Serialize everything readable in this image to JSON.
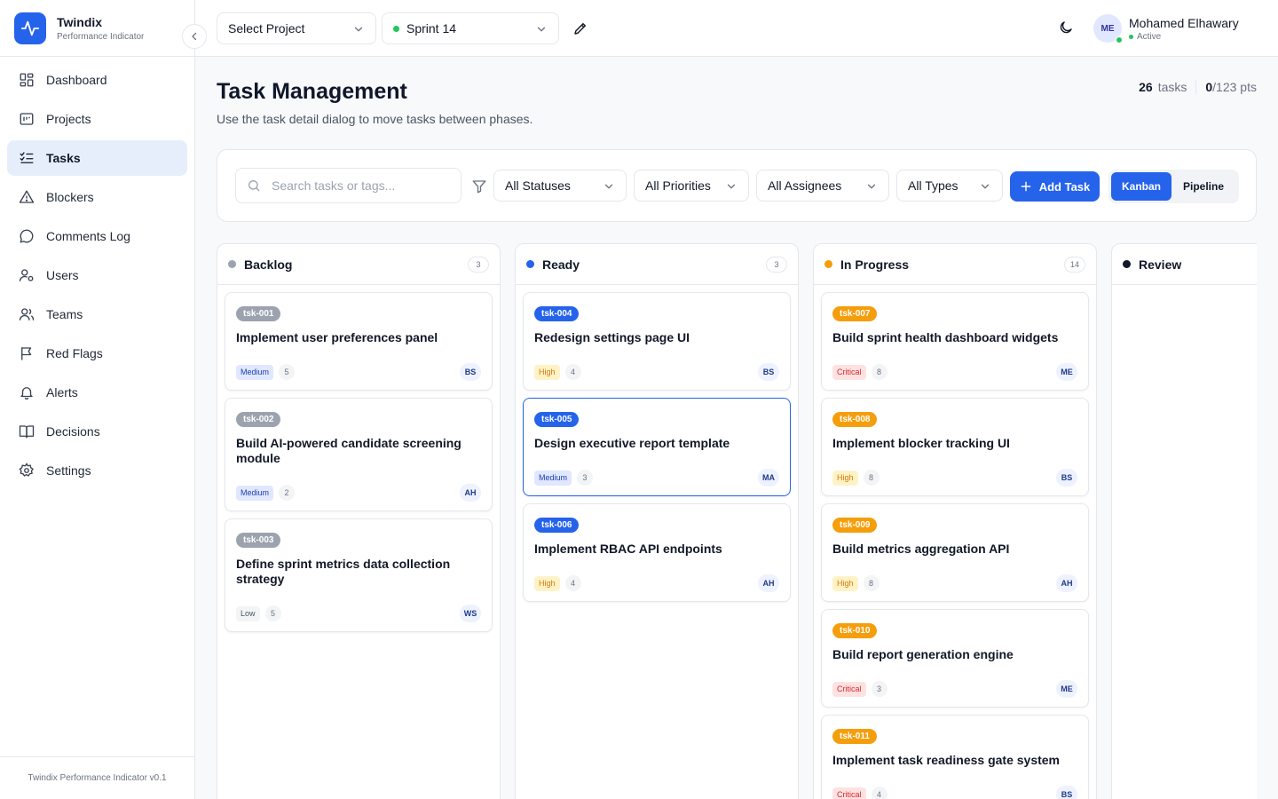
{
  "brand": {
    "name": "Twindix",
    "subtitle": "Performance Indicator"
  },
  "sidebar": {
    "items": [
      {
        "label": "Dashboard",
        "icon": "dashboard-icon"
      },
      {
        "label": "Projects",
        "icon": "projects-icon"
      },
      {
        "label": "Tasks",
        "icon": "tasks-icon",
        "active": true
      },
      {
        "label": "Blockers",
        "icon": "warning-icon"
      },
      {
        "label": "Comments Log",
        "icon": "comment-icon"
      },
      {
        "label": "Users",
        "icon": "user-gear-icon"
      },
      {
        "label": "Teams",
        "icon": "teams-icon"
      },
      {
        "label": "Red Flags",
        "icon": "flag-icon"
      },
      {
        "label": "Alerts",
        "icon": "bell-icon"
      },
      {
        "label": "Decisions",
        "icon": "book-icon"
      },
      {
        "label": "Settings",
        "icon": "gear-icon"
      }
    ],
    "footer": "Twindix Performance Indicator v0.1"
  },
  "topbar": {
    "project_select": "Select Project",
    "sprint_select": "Sprint 14",
    "user": {
      "initials": "ME",
      "name": "Mohamed Elhawary",
      "status": "Active"
    }
  },
  "page": {
    "title": "Task Management",
    "subtitle": "Use the task detail dialog to move tasks between phases.",
    "stats": {
      "tasks_count": "26",
      "tasks_label": "tasks",
      "points_done": "0",
      "points_total": "/123 pts"
    }
  },
  "toolbar": {
    "search_placeholder": "Search tasks or tags...",
    "status_filter": "All Statuses",
    "priority_filter": "All Priorities",
    "assignee_filter": "All Assignees",
    "type_filter": "All Types",
    "add_label": "Add Task",
    "view_kanban": "Kanban",
    "view_pipeline": "Pipeline"
  },
  "colors": {
    "accent": "#2563eb",
    "gray_dot": "#9ca3af",
    "orange": "#f59e0b",
    "critical": "#dc2626",
    "high": "#d97706",
    "medium": "#1d4ed8",
    "low": "#4b5563"
  },
  "columns": [
    {
      "title": "Backlog",
      "count": "3",
      "cards": [
        {
          "id": "tsk-001",
          "title": "Implement user preferences panel",
          "priority": "Medium",
          "points": "5",
          "assignee": "BS"
        },
        {
          "id": "tsk-002",
          "title": "Build AI-powered candidate screening module",
          "priority": "Medium",
          "points": "2",
          "assignee": "AH"
        },
        {
          "id": "tsk-003",
          "title": "Define sprint metrics data collection strategy",
          "priority": "Low",
          "points": "5",
          "assignee": "WS"
        }
      ]
    },
    {
      "title": "Ready",
      "count": "3",
      "cards": [
        {
          "id": "tsk-004",
          "title": "Redesign settings page UI",
          "priority": "High",
          "points": "4",
          "assignee": "BS"
        },
        {
          "id": "tsk-005",
          "title": "Design executive report template",
          "priority": "Medium",
          "points": "3",
          "assignee": "MA"
        },
        {
          "id": "tsk-006",
          "title": "Implement RBAC API endpoints",
          "priority": "High",
          "points": "4",
          "assignee": "AH"
        }
      ]
    },
    {
      "title": "In Progress",
      "count": "14",
      "cards": [
        {
          "id": "tsk-007",
          "title": "Build sprint health dashboard widgets",
          "priority": "Critical",
          "points": "8",
          "assignee": "ME"
        },
        {
          "id": "tsk-008",
          "title": "Implement blocker tracking UI",
          "priority": "High",
          "points": "8",
          "assignee": "BS"
        },
        {
          "id": "tsk-009",
          "title": "Build metrics aggregation API",
          "priority": "High",
          "points": "8",
          "assignee": "AH"
        },
        {
          "id": "tsk-010",
          "title": "Build report generation engine",
          "priority": "Critical",
          "points": "3",
          "assignee": "ME"
        },
        {
          "id": "tsk-011",
          "title": "Implement task readiness gate system",
          "priority": "Critical",
          "points": "4",
          "assignee": "BS"
        }
      ]
    },
    {
      "title": "Review",
      "count": "",
      "cards": []
    }
  ]
}
